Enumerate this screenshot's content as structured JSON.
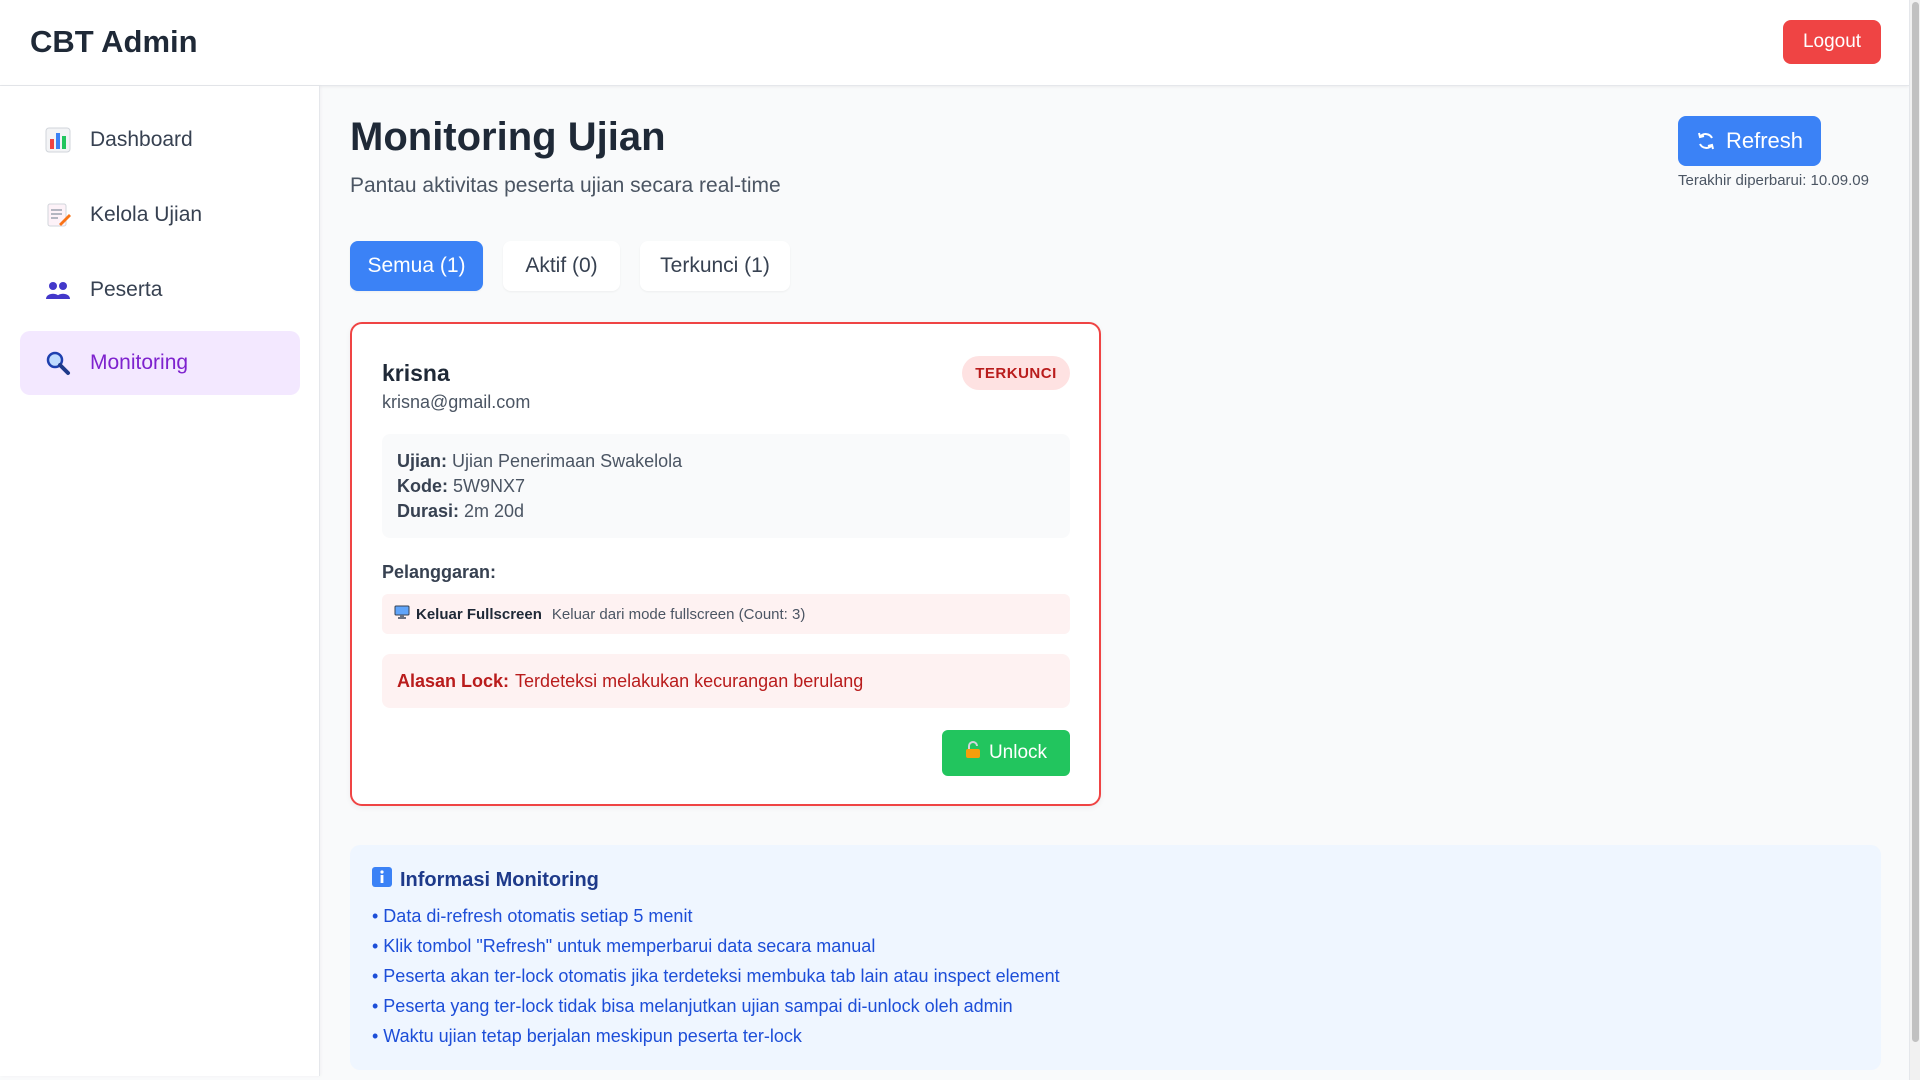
{
  "header": {
    "title": "CBT Admin",
    "logout_label": "Logout"
  },
  "sidebar": {
    "items": [
      {
        "label": "Dashboard",
        "icon": "bar-chart-icon",
        "active": false
      },
      {
        "label": "Kelola Ujian",
        "icon": "memo-icon",
        "active": false
      },
      {
        "label": "Peserta",
        "icon": "users-icon",
        "active": false
      },
      {
        "label": "Monitoring",
        "icon": "magnifier-icon",
        "active": true
      }
    ]
  },
  "main": {
    "title": "Monitoring Ujian",
    "subtitle": "Pantau aktivitas peserta ujian secara real-time",
    "refresh_label": "Refresh",
    "last_updated": "Terakhir diperbarui: 10.09.09",
    "tabs": [
      {
        "label": "Semua (1)",
        "active": true
      },
      {
        "label": "Aktif (0)",
        "active": false
      },
      {
        "label": "Terkunci (1)",
        "active": false
      }
    ]
  },
  "participant": {
    "name": "krisna",
    "email": "krisna@gmail.com",
    "status": "TERKUNCI",
    "exam_label": "Ujian:",
    "exam_value": "Ujian Penerimaan Swakelola",
    "code_label": "Kode:",
    "code_value": "5W9NX7",
    "duration_label": "Durasi:",
    "duration_value": "2m 20d",
    "violations_title": "Pelanggaran:",
    "violations": [
      {
        "icon": "monitor-icon",
        "type": "Keluar Fullscreen",
        "description": "Keluar dari mode fullscreen (Count: 3)"
      }
    ],
    "lock_reason_label": "Alasan Lock:",
    "lock_reason_value": "Terdeteksi melakukan kecurangan berulang",
    "unlock_label": "Unlock"
  },
  "info": {
    "title": "Informasi Monitoring",
    "items": [
      "• Data di-refresh otomatis setiap 5 menit",
      "• Klik tombol \"Refresh\" untuk memperbarui data secara manual",
      "• Peserta akan ter-lock otomatis jika terdeteksi membuka tab lain atau inspect element",
      "• Peserta yang ter-lock tidak bisa melanjutkan ujian sampai di-unlock oleh admin",
      "• Waktu ujian tetap berjalan meskipun peserta ter-lock"
    ]
  },
  "colors": {
    "primary": "#3b82f6",
    "danger": "#ef4444",
    "success": "#22c55e",
    "active_nav_bg": "#f3e8ff",
    "active_nav_text": "#7e22ce"
  }
}
